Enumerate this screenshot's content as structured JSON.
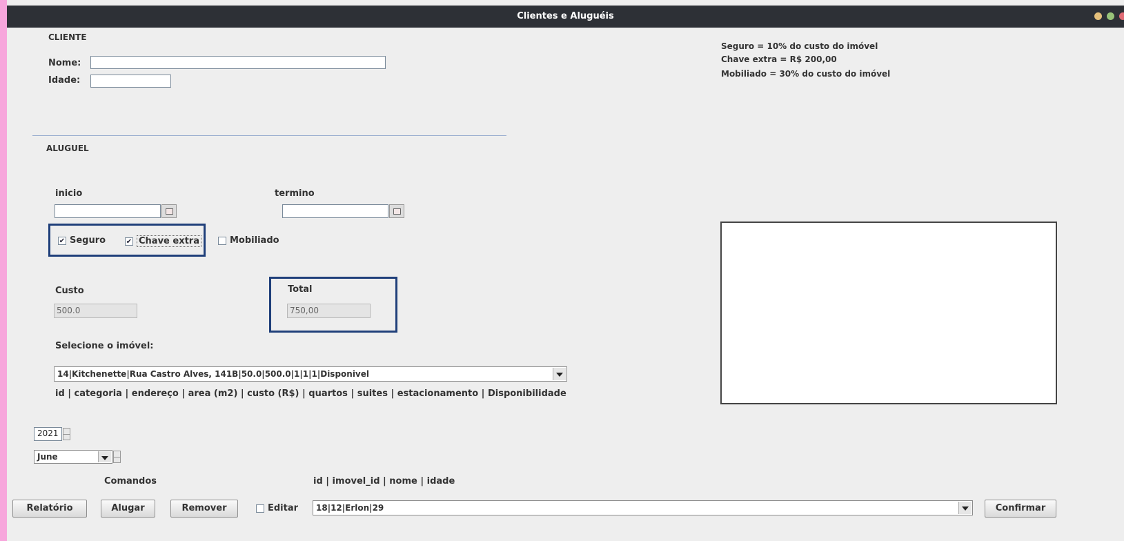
{
  "window": {
    "title": "Clientes e Aluguéis",
    "dot_colors": [
      "#e5c07b",
      "#98c379",
      "#e06c75"
    ]
  },
  "cliente": {
    "section": "CLIENTE",
    "nome_label": "Nome:",
    "nome_value": "",
    "idade_label": "Idade:",
    "idade_value": ""
  },
  "info": [
    "Seguro = 10% do custo do imóvel",
    "Chave extra = R$ 200,00",
    "Mobiliado = 30% do custo do imóvel"
  ],
  "aluguel": {
    "section": "ALUGUEL",
    "inicio_label": "inicio",
    "inicio_value": "",
    "termino_label": "termino",
    "termino_value": "",
    "seguro_label": "Seguro",
    "seguro_checked": true,
    "chave_label": "Chave extra",
    "chave_checked": true,
    "mobiliado_label": "Mobiliado",
    "mobiliado_checked": false,
    "custo_label": "Custo",
    "custo_value": "500.0",
    "total_label": "Total",
    "total_value": "750,00",
    "imovel_label": "Selecione o imóvel:",
    "imovel_selected": "14|Kitchenette|Rua Castro Alves, 141B|50.0|500.0|1|1|1|Disponivel",
    "imovel_header": "id | categoria | endereço | area (m2) | custo (R$) | quartos | suites | estacionamento | Disponibilidade"
  },
  "calendar": {
    "year": "2021",
    "month": "June"
  },
  "commands": {
    "title": "Comandos",
    "relatorio": "Relatório",
    "alugar": "Alugar",
    "remover": "Remover",
    "editar_label": "Editar",
    "editar_checked": false,
    "list_header": "id | imovel_id | nome | idade",
    "list_selected": "18|12|Erlon|29",
    "confirmar": "Confirmar"
  },
  "colors": {
    "highlight": "#1f3f7a",
    "titlebar": "#2d3036",
    "background": "#f7a6dc"
  }
}
